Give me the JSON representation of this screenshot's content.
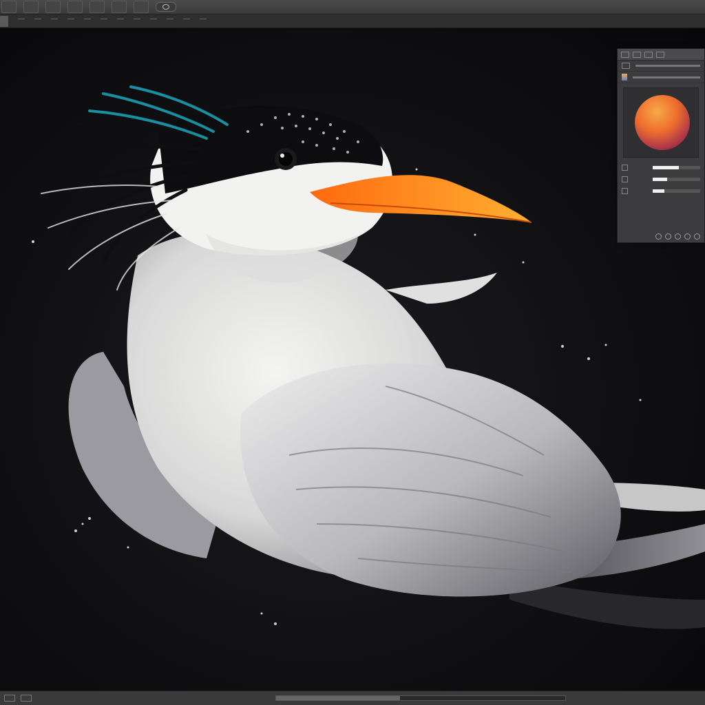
{
  "menu": {
    "items": [
      "",
      "",
      "",
      "",
      "",
      "",
      ""
    ]
  },
  "options": {
    "document_tab": "",
    "ticks": 12
  },
  "panel": {
    "rows": [
      {
        "label": ""
      },
      {
        "label": ""
      }
    ],
    "sliders": [
      {
        "label": "",
        "value": 0.55
      },
      {
        "label": "",
        "value": 0.3
      },
      {
        "label": "",
        "value": 0.25
      }
    ],
    "orb_colors": [
      "#f7a948",
      "#ee6e2e",
      "#a8324a",
      "#3a2040"
    ]
  },
  "artwork": {
    "beak_color": "#ff7a1a",
    "crest_accent": "#1a8fa0",
    "body_color": "#e9e9e9"
  }
}
